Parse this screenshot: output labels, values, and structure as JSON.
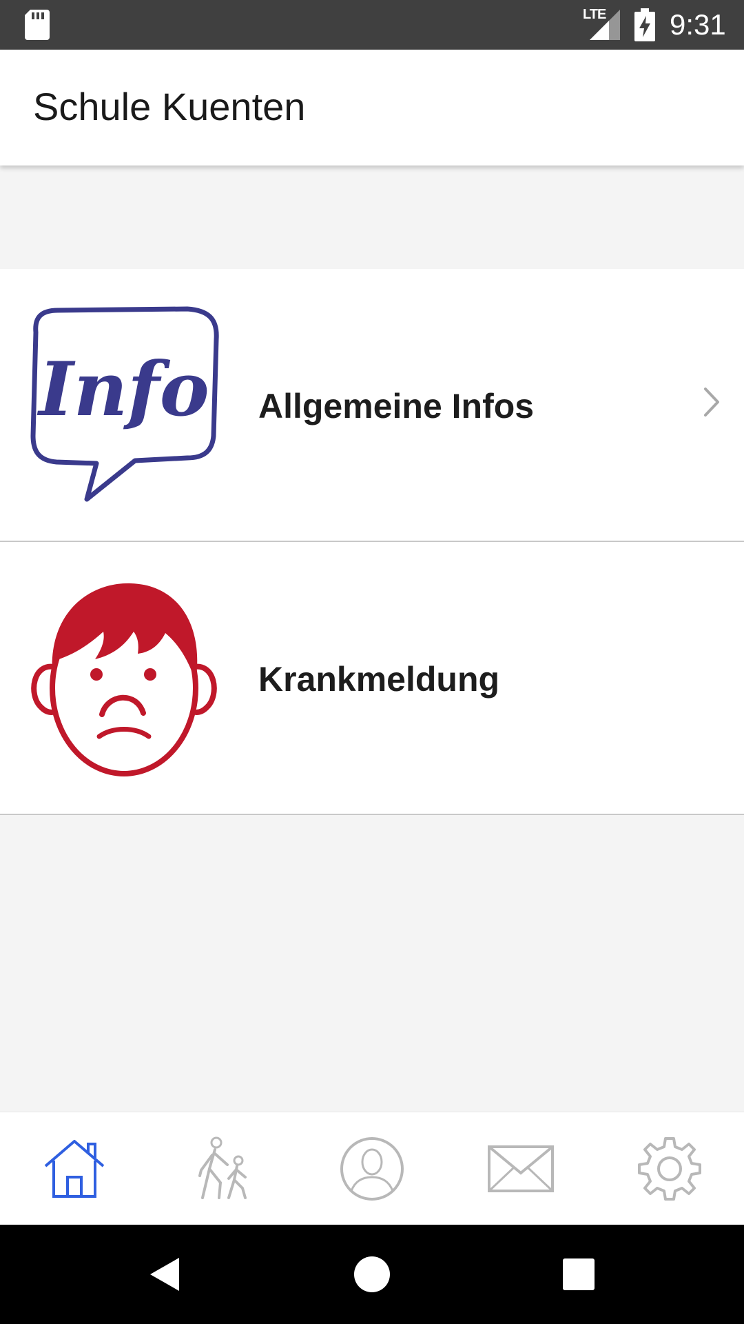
{
  "status_bar": {
    "time": "9:31",
    "network": "LTE",
    "icons": [
      "sd-card-icon",
      "lte-signal-icon",
      "battery-charging-icon"
    ]
  },
  "app_bar": {
    "title": "Schule Kuenten"
  },
  "list": {
    "items": [
      {
        "label": "Allgemeine Infos",
        "icon": "info-speech-bubble-icon",
        "image_text": "Info",
        "has_chevron": true
      },
      {
        "label": "Krankmeldung",
        "icon": "sad-face-icon",
        "has_chevron": false
      }
    ]
  },
  "bottom_nav": {
    "tabs": [
      {
        "icon": "home-icon",
        "active": true
      },
      {
        "icon": "walking-people-icon",
        "active": false
      },
      {
        "icon": "profile-icon",
        "active": false
      },
      {
        "icon": "mail-icon",
        "active": false
      },
      {
        "icon": "gear-icon",
        "active": false
      }
    ]
  },
  "system_nav": {
    "buttons": [
      "back-icon",
      "home-circle-icon",
      "recents-icon"
    ]
  },
  "colors": {
    "status_bar": "#404040",
    "background": "#f4f4f4",
    "active_tab": "#2f5fe0",
    "inactive_tab": "#b8b8b8",
    "info_blue": "#3a3a8c",
    "sad_red": "#c0182a"
  }
}
